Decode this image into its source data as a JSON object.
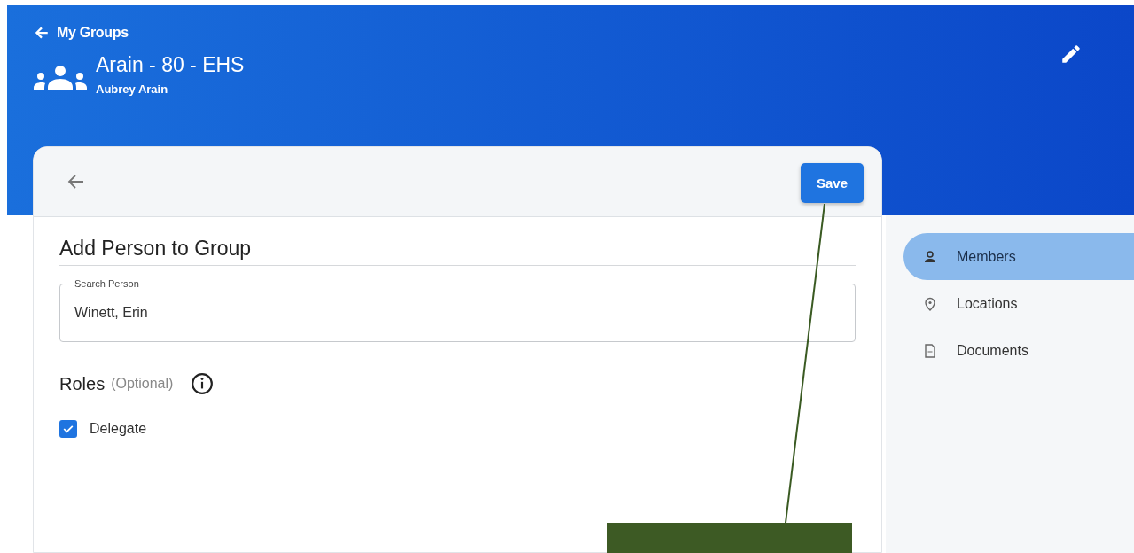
{
  "header": {
    "back_link": "My Groups",
    "title": "Arain - 80 - EHS",
    "subtitle": "Aubrey Arain"
  },
  "card": {
    "save_button": "Save",
    "heading": "Add Person to Group",
    "search": {
      "label": "Search Person",
      "value": "Winett, Erin"
    },
    "roles_title": "Roles",
    "roles_hint": "(Optional)",
    "roles": [
      {
        "label": "Delegate",
        "checked": true
      }
    ]
  },
  "sidebar": {
    "items": [
      {
        "label": "Members",
        "kind": "person",
        "selected": true
      },
      {
        "label": "Locations",
        "kind": "pin",
        "selected": false
      },
      {
        "label": "Documents",
        "kind": "document",
        "selected": false
      }
    ]
  }
}
